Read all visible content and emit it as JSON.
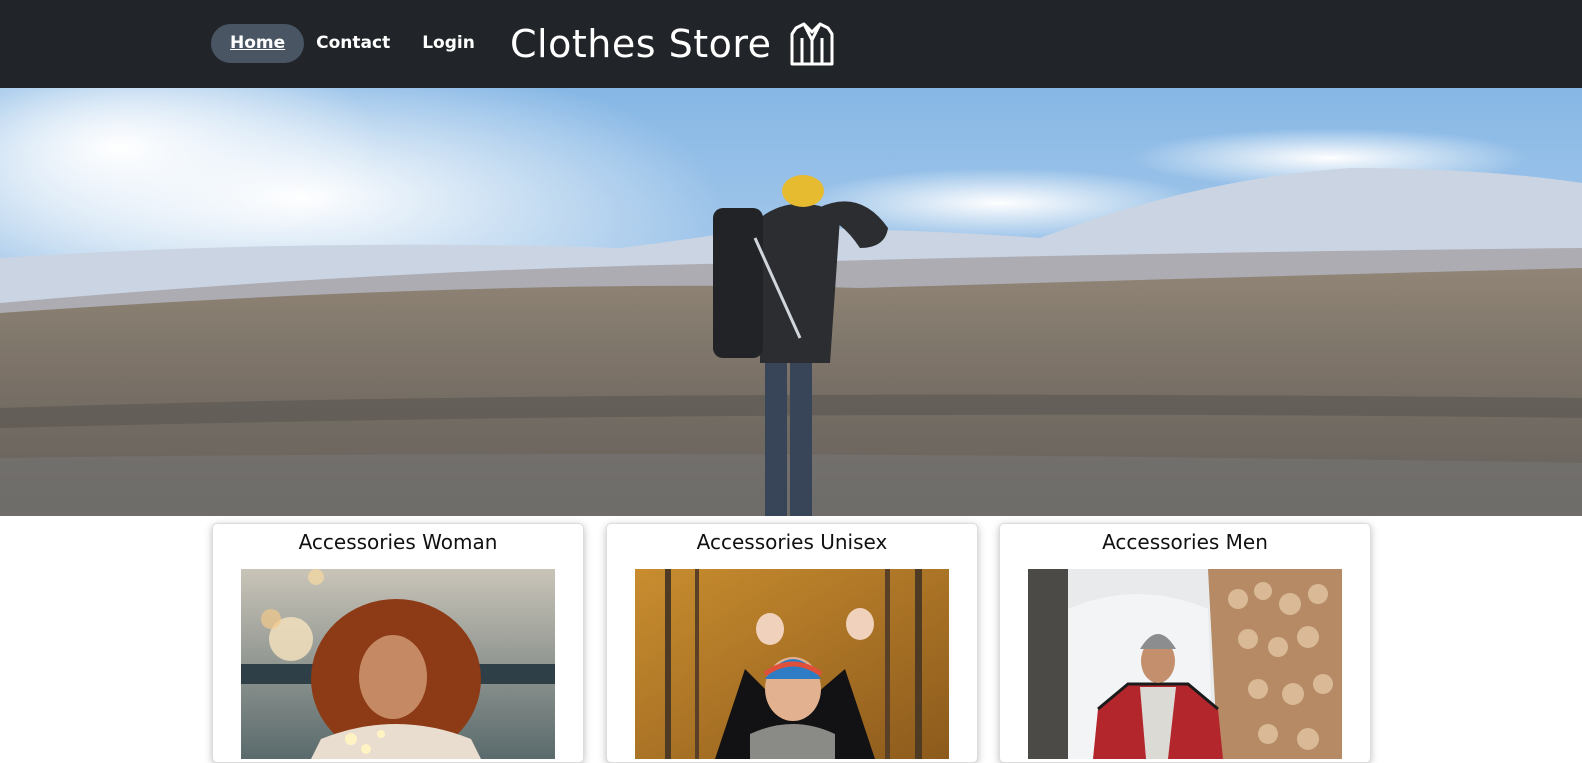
{
  "nav": {
    "links": [
      {
        "label": "Home",
        "active": true
      },
      {
        "label": "Contact",
        "active": false
      },
      {
        "label": "Login",
        "active": false
      }
    ],
    "brand": "Clothes Store",
    "brand_icon": "jacket-icon"
  },
  "hero": {
    "image": "hiker-mountain-landscape"
  },
  "categories": [
    {
      "title": "Accessories Woman",
      "image": "woman-with-lights-photo"
    },
    {
      "title": "Accessories Unisex",
      "image": "child-in-autumn-forest-photo"
    },
    {
      "title": "Accessories Men",
      "image": "man-in-snow-photo"
    }
  ],
  "colors": {
    "navbar": "#212529",
    "active_pill": "#4a5563"
  }
}
